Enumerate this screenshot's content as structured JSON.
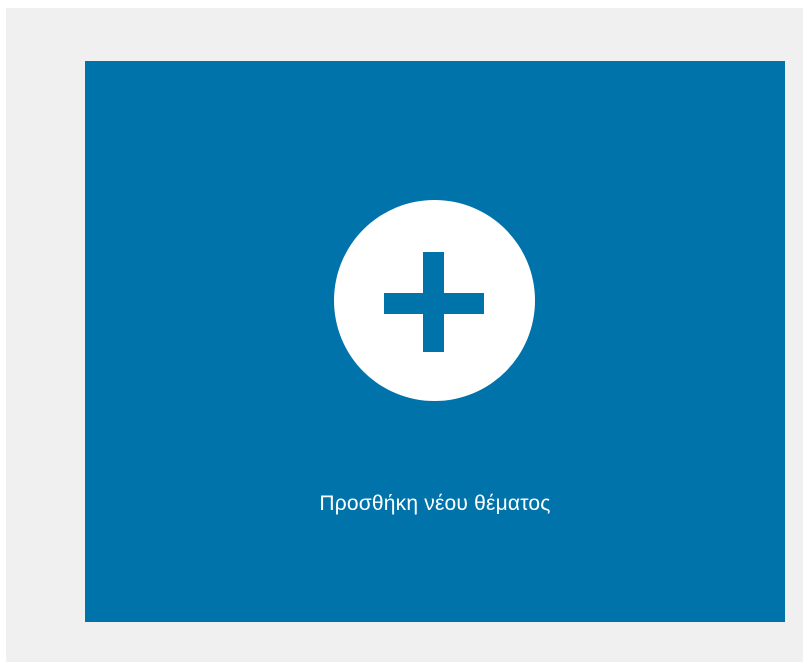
{
  "add_tile": {
    "label": "Προσθήκη νέου θέματος",
    "icon": "plus-circle-icon",
    "background_color": "#0073aa",
    "icon_color": "#ffffff"
  },
  "page": {
    "background_color": "#f0f0f0"
  }
}
